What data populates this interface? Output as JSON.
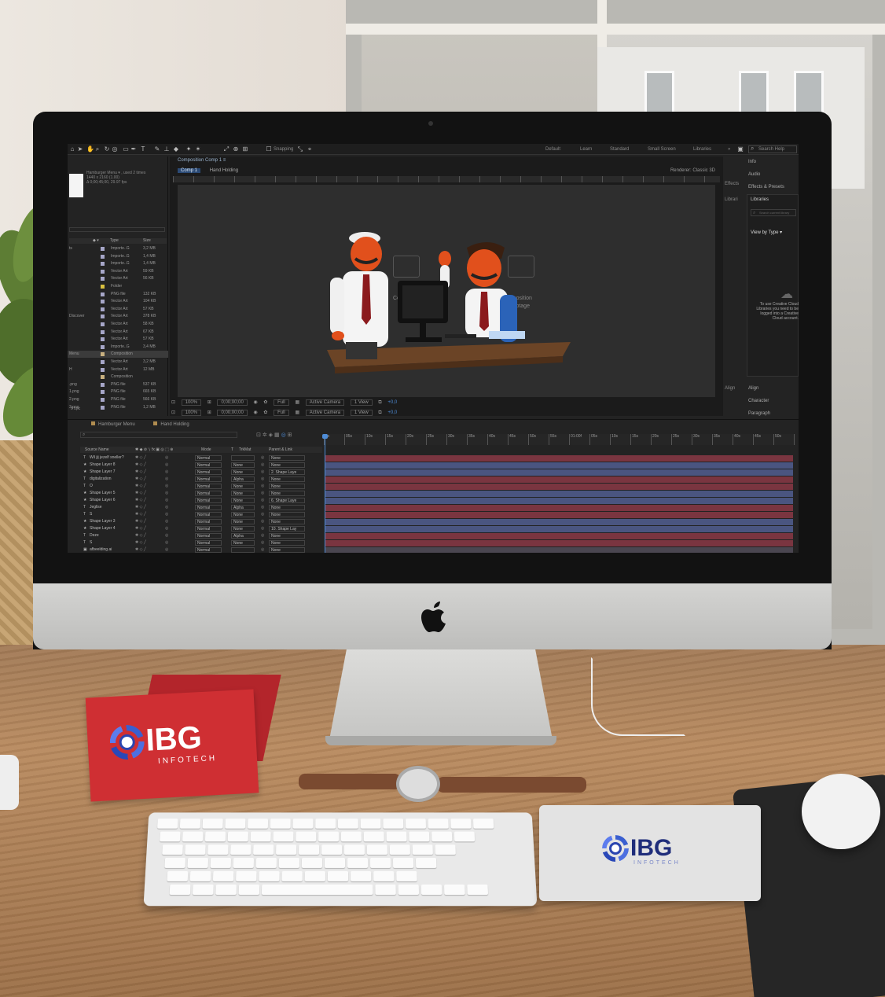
{
  "app": {
    "toolbar": {
      "snapping_label": "Snapping",
      "workspaces": [
        "Default",
        "Learn",
        "Standard",
        "Small Screen",
        "Libraries"
      ],
      "overflow": "»",
      "search_placeholder": "Search Help"
    },
    "project_panel": {
      "comp_name": "Hamburger Menu ▾ , used 2 times",
      "comp_info_1": "1440 x 2160 (1.00)",
      "comp_info_2": "Δ 0;00;45;00, 29.97 fps",
      "columns": [
        "Name",
        "Type",
        "Size"
      ],
      "rows": [
        {
          "name": "ts",
          "type": "Importe..G",
          "size": "3,2 MB",
          "color": "#a6a6c8"
        },
        {
          "name": "",
          "type": "Importe..G",
          "size": "1,4 MB",
          "color": "#a6a6c8"
        },
        {
          "name": "",
          "type": "Importe..G",
          "size": "1,4 MB",
          "color": "#a6a6c8"
        },
        {
          "name": "",
          "type": "Vector Art",
          "size": "59 KB",
          "color": "#a6a6c8"
        },
        {
          "name": "",
          "type": "Vector Art",
          "size": "56 KB",
          "color": "#a6a6c8"
        },
        {
          "name": "",
          "type": "Folder",
          "size": "",
          "color": "#d8c040"
        },
        {
          "name": "",
          "type": "PNG file",
          "size": "132 KB",
          "color": "#a6a6c8"
        },
        {
          "name": "",
          "type": "Vector Art",
          "size": "104 KB",
          "color": "#a6a6c8"
        },
        {
          "name": "",
          "type": "Vector Art",
          "size": "57 KB",
          "color": "#a6a6c8"
        },
        {
          "name": "Discover",
          "type": "Vector Art",
          "size": "378 KB",
          "color": "#a6a6c8"
        },
        {
          "name": "",
          "type": "Vector Art",
          "size": "58 KB",
          "color": "#a6a6c8"
        },
        {
          "name": "",
          "type": "Vector Art",
          "size": "67 KB",
          "color": "#a6a6c8"
        },
        {
          "name": "",
          "type": "Vector Art",
          "size": "57 KB",
          "color": "#a6a6c8"
        },
        {
          "name": "",
          "type": "Importe..G",
          "size": "3,4 MB",
          "color": "#a6a6c8"
        },
        {
          "name": "Menu",
          "type": "Composition",
          "size": "",
          "color": "#c8b080"
        },
        {
          "name": "",
          "type": "Vector Art",
          "size": "3,2 MB",
          "color": "#a6a6c8"
        },
        {
          "name": "H",
          "type": "Vector Art",
          "size": "12 MB",
          "color": "#a6a6c8"
        },
        {
          "name": "",
          "type": "Composition",
          "size": "",
          "color": "#c8b080"
        },
        {
          "name": ".png",
          "type": "PNG file",
          "size": "537 KB",
          "color": "#a6a6c8"
        },
        {
          "name": "1.png",
          "type": "PNG file",
          "size": "665 KB",
          "color": "#a6a6c8"
        },
        {
          "name": "2.png",
          "type": "PNG file",
          "size": "566 KB",
          "color": "#a6a6c8"
        },
        {
          "name": "3.png",
          "type": "PNG file",
          "size": "1,2 MB",
          "color": "#a6a6c8"
        }
      ],
      "footer": "8 bpc"
    },
    "composition": {
      "title": "Composition Comp 1 ≡",
      "tabs": [
        "Comp 1",
        "Hand Holding"
      ],
      "renderer_label": "Renderer:",
      "renderer_value": "Classic 3D",
      "ghost_left": "Composition",
      "ghost_right_1": "New Composition",
      "ghost_right_2": "From Footage",
      "view_bar": {
        "zoom": "100%",
        "time": "0;00;00;00",
        "resolution": "Full",
        "camera": "Active Camera",
        "views": "1 View",
        "offset": "+0,0"
      }
    },
    "right_panel": {
      "items": [
        "Info",
        "Audio",
        "Effects & Presets",
        "Libraries"
      ],
      "left_labels": [
        "Effects",
        "Librari"
      ],
      "libraries_title": "Libraries",
      "libraries_search": "Search current library",
      "view_by": "View by Type",
      "cc_message": "To use Creative Cloud Libraries you need to be logged into a Creative Cloud account.",
      "bottom_items": [
        "Align",
        "Character",
        "Paragraph"
      ],
      "bottom_left": [
        "Align"
      ]
    },
    "timeline": {
      "tabs": [
        "Hamburger Menu",
        "Hand Holding"
      ],
      "search_placeholder": "",
      "columns": [
        "Source Name",
        "Mode",
        "T",
        "TrkMat",
        "Parent & Link"
      ],
      "time_ticks": [
        "0s",
        "05s",
        "10s",
        "15s",
        "20s",
        "25s",
        "30s",
        "35s",
        "40s",
        "45s",
        "50s",
        "55s",
        "01:00f",
        "05s",
        "10s",
        "15s",
        "20s",
        "25s",
        "30s",
        "35s",
        "40s",
        "45s",
        "50s"
      ],
      "layers": [
        {
          "icon": "T",
          "name": "Wil jij jezelf sneller?",
          "mode": "Normal",
          "trkmat": "",
          "parent": "None",
          "bar": "red"
        },
        {
          "icon": "★",
          "name": "Shape Layer 8",
          "mode": "Normal",
          "trkmat": "None",
          "parent": "None",
          "bar": "blue"
        },
        {
          "icon": "★",
          "name": "Shape Layer 7",
          "mode": "Normal",
          "trkmat": "None",
          "parent": "2. Shape Laye",
          "bar": "blue"
        },
        {
          "icon": "T",
          "name": "digitalization",
          "mode": "Normal",
          "trkmat": "Alpha",
          "parent": "None",
          "bar": "red"
        },
        {
          "icon": "T",
          "name": "O",
          "mode": "Normal",
          "trkmat": "None",
          "parent": "None",
          "bar": "red"
        },
        {
          "icon": "★",
          "name": "Shape Layer 5",
          "mode": "Normal",
          "trkmat": "None",
          "parent": "None",
          "bar": "blue"
        },
        {
          "icon": "★",
          "name": "Shape Layer 6",
          "mode": "Normal",
          "trkmat": "None",
          "parent": "6. Shape Laye",
          "bar": "blue"
        },
        {
          "icon": "T",
          "name": "Jeglise",
          "mode": "Normal",
          "trkmat": "Alpha",
          "parent": "None",
          "bar": "red"
        },
        {
          "icon": "T",
          "name": "S",
          "mode": "Normal",
          "trkmat": "None",
          "parent": "None",
          "bar": "red"
        },
        {
          "icon": "★",
          "name": "Shape Layer 3",
          "mode": "Normal",
          "trkmat": "None",
          "parent": "None",
          "bar": "blue"
        },
        {
          "icon": "★",
          "name": "Shape Layer 4",
          "mode": "Normal",
          "trkmat": "None",
          "parent": "10. Shape Lay",
          "bar": "blue"
        },
        {
          "icon": "T",
          "name": "Deze",
          "mode": "Normal",
          "trkmat": "Alpha",
          "parent": "None",
          "bar": "red"
        },
        {
          "icon": "T",
          "name": "S",
          "mode": "Normal",
          "trkmat": "None",
          "parent": "None",
          "bar": "red"
        },
        {
          "icon": "▣",
          "name": "afbeelding.ai",
          "mode": "Normal",
          "trkmat": "",
          "parent": "None",
          "bar": "gray"
        }
      ]
    }
  },
  "branding": {
    "card_word": "IBG",
    "card_sub": "INFOTECH",
    "pad_word": "IBG",
    "pad_sub": "INFOTECH"
  },
  "colors": {
    "accent": "#4e8cd6",
    "card_red": "#cf2f33",
    "logo_blue": "#2a45b0",
    "bar_red": "#7a3540",
    "bar_blue": "#4a5580"
  }
}
